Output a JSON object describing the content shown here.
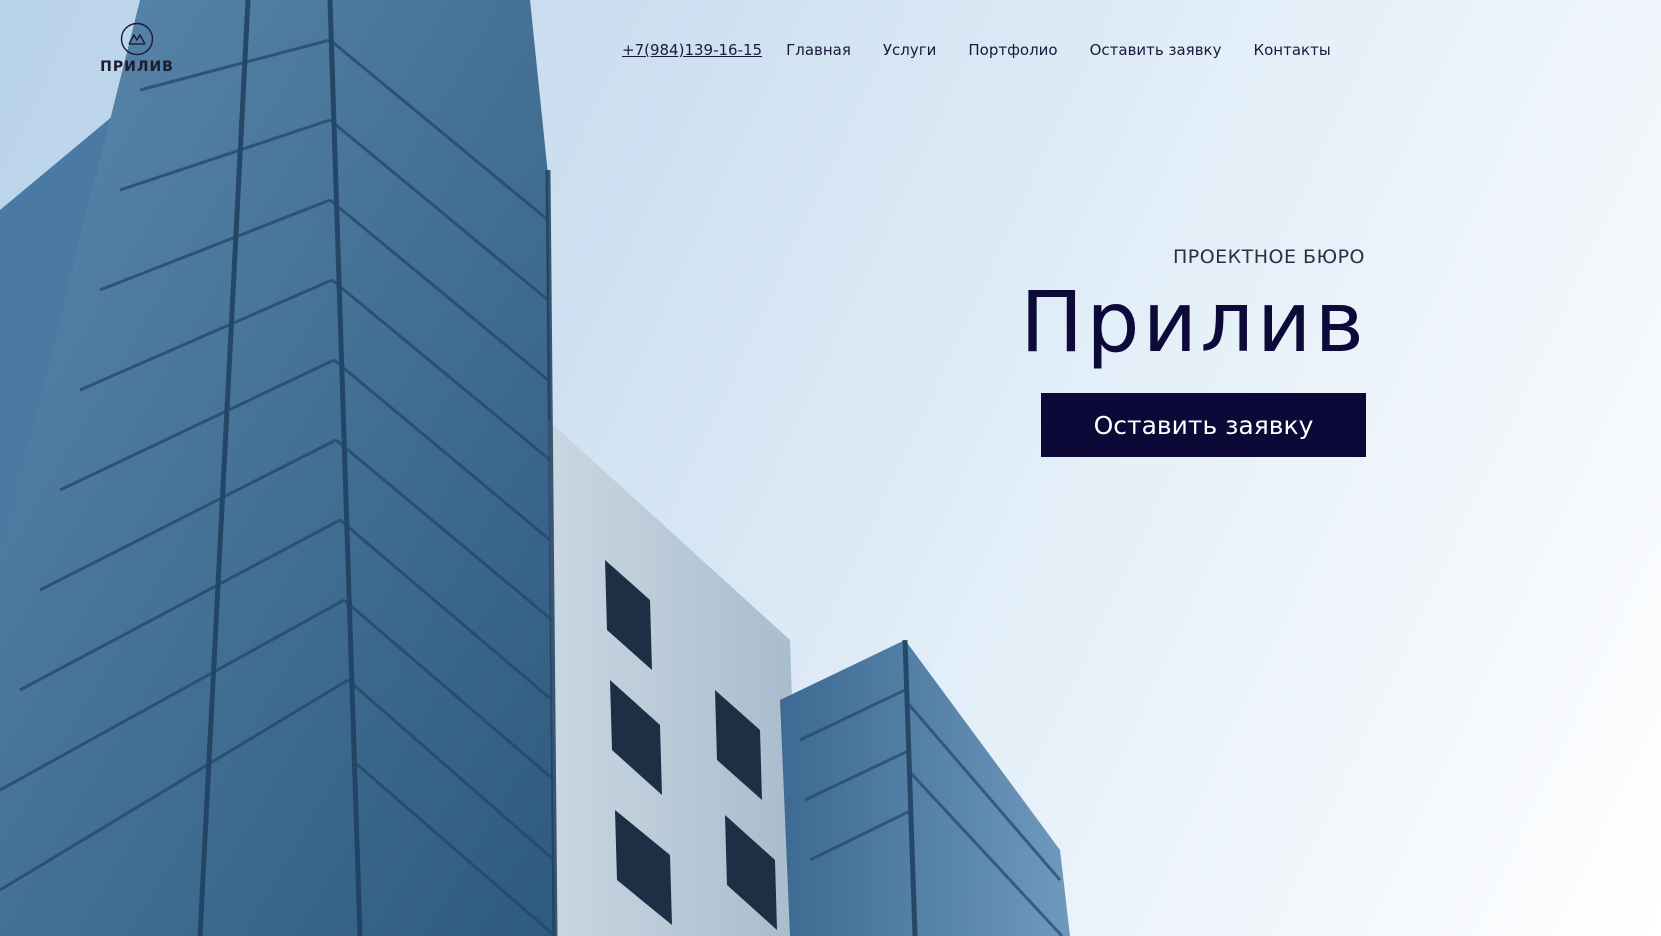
{
  "brand": {
    "name": "ПРИЛИВ",
    "logo_icon": "mountain-circle-icon"
  },
  "nav": {
    "phone": "+7(984)139-16-15",
    "items": [
      "Главная",
      "Услуги",
      "Портфолио",
      "Оставить заявку",
      "Контакты"
    ]
  },
  "hero": {
    "subtitle": "ПРОЕКТНОЕ БЮРО",
    "title": "Прилив",
    "cta_label": "Оставить заявку",
    "background_image": "glass-building-against-sky"
  },
  "colors": {
    "primary": "#0c0838",
    "text": "#1a1a3a",
    "sky_light": "#f4f8fc",
    "sky_blue": "#b9d3ea"
  }
}
